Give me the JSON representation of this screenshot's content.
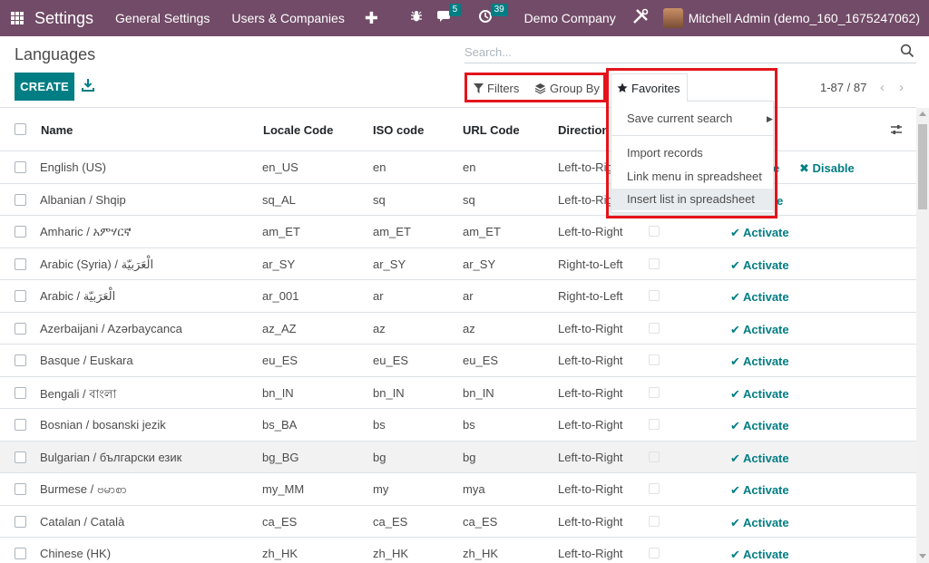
{
  "navbar": {
    "app_title": "Settings",
    "menu_general": "General Settings",
    "menu_users": "Users & Companies",
    "plus": "✚",
    "messages_count": "5",
    "activities_count": "39",
    "company": "Demo Company",
    "user": "Mitchell Admin (demo_160_1675247062)"
  },
  "page": {
    "title": "Languages",
    "create_label": "CREATE",
    "search_placeholder": "Search...",
    "filters_label": "Filters",
    "groupby_label": "Group By",
    "favorites_label": "Favorites",
    "pager": "1-87 / 87"
  },
  "favorites_menu": {
    "save_search": "Save current search",
    "import_records": "Import records",
    "link_menu": "Link menu in spreadsheet",
    "insert_list": "Insert list in spreadsheet"
  },
  "table": {
    "headers": {
      "name": "Name",
      "locale": "Locale Code",
      "iso": "ISO code",
      "url": "URL Code",
      "direction": "Direction"
    },
    "rows": [
      {
        "name": "English (US)",
        "locale": "en_US",
        "iso": "en",
        "url": "en",
        "direction": "Left-to-Right",
        "action": "Disable",
        "extra": "e"
      },
      {
        "name": "Albanian / Shqip",
        "locale": "sq_AL",
        "iso": "sq",
        "url": "sq",
        "direction": "Left-to-Right",
        "action": "e"
      },
      {
        "name": "Amharic / አምሃርኛ",
        "locale": "am_ET",
        "iso": "am_ET",
        "url": "am_ET",
        "direction": "Left-to-Right",
        "action": "Activate"
      },
      {
        "name": "Arabic (Syria) / الْعَرَبيّة",
        "locale": "ar_SY",
        "iso": "ar_SY",
        "url": "ar_SY",
        "direction": "Right-to-Left",
        "action": "Activate"
      },
      {
        "name": "Arabic / الْعَرَبيّة",
        "locale": "ar_001",
        "iso": "ar",
        "url": "ar",
        "direction": "Right-to-Left",
        "action": "Activate"
      },
      {
        "name": "Azerbaijani / Azərbaycanca",
        "locale": "az_AZ",
        "iso": "az",
        "url": "az",
        "direction": "Left-to-Right",
        "action": "Activate"
      },
      {
        "name": "Basque / Euskara",
        "locale": "eu_ES",
        "iso": "eu_ES",
        "url": "eu_ES",
        "direction": "Left-to-Right",
        "action": "Activate"
      },
      {
        "name": "Bengali / বাংলা",
        "locale": "bn_IN",
        "iso": "bn_IN",
        "url": "bn_IN",
        "direction": "Left-to-Right",
        "action": "Activate"
      },
      {
        "name": "Bosnian / bosanski jezik",
        "locale": "bs_BA",
        "iso": "bs",
        "url": "bs",
        "direction": "Left-to-Right",
        "action": "Activate"
      },
      {
        "name": "Bulgarian / български език",
        "locale": "bg_BG",
        "iso": "bg",
        "url": "bg",
        "direction": "Left-to-Right",
        "action": "Activate"
      },
      {
        "name": "Burmese / ဗမာစာ",
        "locale": "my_MM",
        "iso": "my",
        "url": "mya",
        "direction": "Left-to-Right",
        "action": "Activate"
      },
      {
        "name": "Catalan / Català",
        "locale": "ca_ES",
        "iso": "ca_ES",
        "url": "ca_ES",
        "direction": "Left-to-Right",
        "action": "Activate"
      },
      {
        "name": "Chinese (HK)",
        "locale": "zh_HK",
        "iso": "zh_HK",
        "url": "zh_HK",
        "direction": "Left-to-Right",
        "action": "Activate"
      }
    ]
  },
  "colors": {
    "navbar": "#714b67",
    "accent": "#017e84",
    "highlight": "#e3141b"
  }
}
